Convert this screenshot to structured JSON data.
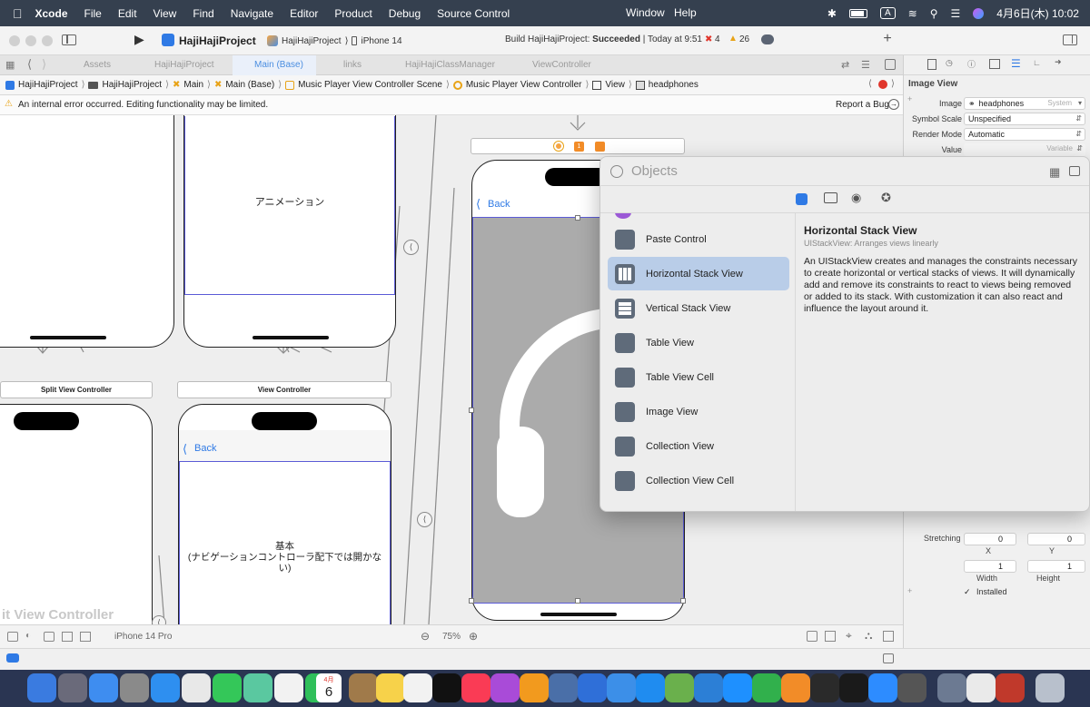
{
  "menubar": {
    "app": "Xcode",
    "items": [
      "File",
      "Edit",
      "View",
      "Find",
      "Navigate",
      "Editor",
      "Product",
      "Debug",
      "Source Control",
      "Window",
      "Help"
    ],
    "input_indicator": "A",
    "clock": "4月6日(木) 10:02"
  },
  "toolbar": {
    "project_name": "HajiHajiProject",
    "scheme": "HajiHajiProject",
    "device": "iPhone 14",
    "build_prefix": "Build HajiHajiProject: ",
    "build_result": "Succeeded",
    "build_time": " | Today at 9:51",
    "error_count": "4",
    "warning_count": "26"
  },
  "tabs": [
    "Assets",
    "HajiHajiProject",
    "Main (Base)",
    "links",
    "HajiHajiClassManager",
    "ViewController"
  ],
  "jumpbar": [
    "HajiHajiProject",
    "HajiHajiProject",
    "Main",
    "Main (Base)",
    "Music Player View Controller Scene",
    "Music Player View Controller",
    "View",
    "headphones"
  ],
  "warning_message": "An internal error occurred. Editing functionality may be limited.",
  "report_bug": "Report a Bug",
  "canvas": {
    "scene_animation_text": "アニメーション",
    "split_view_label": "Split View Controller",
    "view_controller_label": "View Controller",
    "back_label": "Back",
    "basic_text_line1": "基本",
    "basic_text_line2": "(ナビゲーションコントローラ配下では開かな",
    "basic_text_line3": "い)",
    "split_big_label": "it View Controller",
    "scene_badges": [
      "1"
    ]
  },
  "bottombar": {
    "device": "iPhone 14 Pro",
    "zoom": "75%"
  },
  "inspector": {
    "section": "Image View",
    "image_label": "Image",
    "image_value": "headphones",
    "image_hint": "System",
    "symbol_scale_label": "Symbol Scale",
    "symbol_scale_value": "Unspecified",
    "render_mode_label": "Render Mode",
    "render_mode_value": "Automatic",
    "value_label": "Value",
    "value_hint": "Variable",
    "stretching_label": "Stretching",
    "x_value": "0",
    "y_value": "0",
    "x_label": "X",
    "y_label": "Y",
    "width_value": "1",
    "height_value": "1",
    "width_label": "Width",
    "height_label": "Height",
    "installed_label": "Installed"
  },
  "objects_library": {
    "title": "Objects",
    "items": [
      {
        "label": "Paste Control",
        "icon": "paste-control-icon"
      },
      {
        "label": "Horizontal Stack View",
        "icon": "horizontal-stack-icon"
      },
      {
        "label": "Vertical Stack View",
        "icon": "vertical-stack-icon"
      },
      {
        "label": "Table View",
        "icon": "table-view-icon"
      },
      {
        "label": "Table View Cell",
        "icon": "table-cell-icon"
      },
      {
        "label": "Image View",
        "icon": "image-view-icon"
      },
      {
        "label": "Collection View",
        "icon": "collection-view-icon"
      },
      {
        "label": "Collection View Cell",
        "icon": "collection-cell-icon"
      }
    ],
    "selected_index": 1,
    "detail_title": "Horizontal Stack View",
    "detail_subtitle": "UIStackView: Arranges views linearly",
    "detail_body": "An UIStackView creates and manages the constraints necessary to create horizontal or vertical stacks of views. It will dynamically add and remove its constraints to react to views being removed or added to its stack. With customization it can also react and influence the layout around it."
  },
  "dock": {
    "calendar_month": "4月",
    "calendar_day": "6"
  },
  "colors": {
    "accent": "#2f7ae5",
    "selection": "#b9cde8",
    "error": "#e0352b",
    "warning": "#e8a317",
    "menubar": "#35404f"
  }
}
